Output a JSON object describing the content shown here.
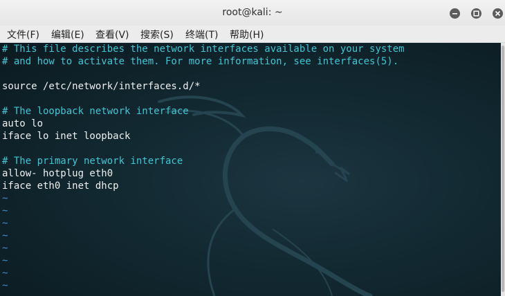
{
  "window": {
    "title": "root@kali: ~"
  },
  "menubar": {
    "items": [
      {
        "label": "文件(F)"
      },
      {
        "label": "编辑(E)"
      },
      {
        "label": "查看(V)"
      },
      {
        "label": "搜索(S)"
      },
      {
        "label": "终端(T)"
      },
      {
        "label": "帮助(H)"
      }
    ]
  },
  "terminal": {
    "lines": [
      {
        "text": "# This file describes the network interfaces available on your system",
        "kind": "comment"
      },
      {
        "text": "# and how to activate them. For more information, see interfaces(5).",
        "kind": "comment"
      },
      {
        "text": "",
        "kind": "blank"
      },
      {
        "text": "source /etc/network/interfaces.d/*",
        "kind": "text"
      },
      {
        "text": "",
        "kind": "blank"
      },
      {
        "text": "# The loopback network interface",
        "kind": "comment"
      },
      {
        "text": "auto lo",
        "kind": "text"
      },
      {
        "text": "iface lo inet loopback",
        "kind": "text"
      },
      {
        "text": "",
        "kind": "blank"
      },
      {
        "text": "# The primary network interface",
        "kind": "comment"
      },
      {
        "text": "allow- hotplug eth0",
        "kind": "text"
      },
      {
        "text": "iface eth0 inet dhcp",
        "kind": "text"
      },
      {
        "text": "~",
        "kind": "tilde"
      },
      {
        "text": "~",
        "kind": "tilde"
      },
      {
        "text": "~",
        "kind": "tilde"
      },
      {
        "text": "~",
        "kind": "tilde"
      },
      {
        "text": "~",
        "kind": "tilde"
      },
      {
        "text": "~",
        "kind": "tilde"
      },
      {
        "text": "~",
        "kind": "tilde"
      },
      {
        "text": "~",
        "kind": "tilde"
      }
    ]
  },
  "colors": {
    "comment": "#3cc7d4",
    "text": "#f0f0f0",
    "tilde": "#3f8fd6",
    "terminal_bg": "#132a33"
  },
  "icons": {
    "minimize": "minimize-icon",
    "maximize": "maximize-icon",
    "close": "close-icon",
    "background": "kali-dragon-logo"
  }
}
